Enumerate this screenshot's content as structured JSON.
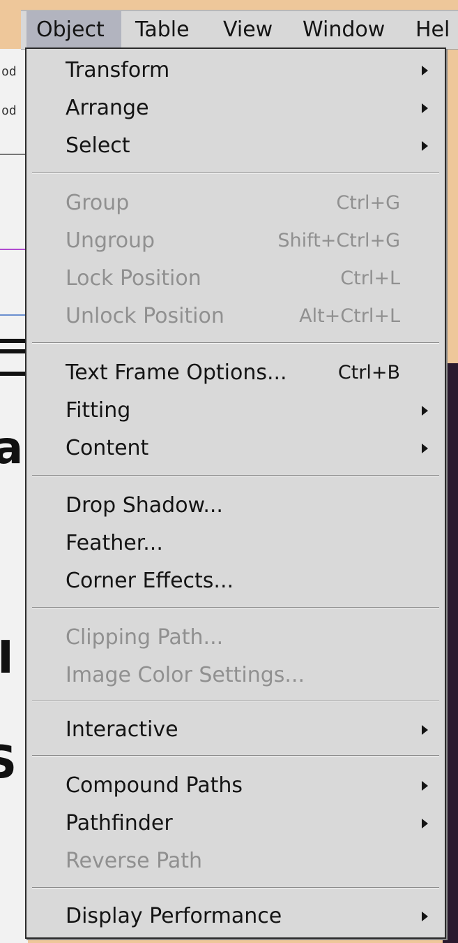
{
  "menubar": {
    "items": [
      {
        "label": "Object",
        "active": true
      },
      {
        "label": "Table"
      },
      {
        "label": "View"
      },
      {
        "label": "Window"
      },
      {
        "label": "Hel"
      }
    ]
  },
  "menu": {
    "items": {
      "transform": {
        "label": "Transform",
        "submenu": true,
        "enabled": true
      },
      "arrange": {
        "label": "Arrange",
        "submenu": true,
        "enabled": true
      },
      "select": {
        "label": "Select",
        "submenu": true,
        "enabled": true
      },
      "group": {
        "label": "Group",
        "shortcut": "Ctrl+G",
        "enabled": false
      },
      "ungroup": {
        "label": "Ungroup",
        "shortcut": "Shift+Ctrl+G",
        "enabled": false
      },
      "lock_position": {
        "label": "Lock Position",
        "shortcut": "Ctrl+L",
        "enabled": false
      },
      "unlock_position": {
        "label": "Unlock Position",
        "shortcut": "Alt+Ctrl+L",
        "enabled": false
      },
      "text_frame_options": {
        "label": "Text Frame Options...",
        "shortcut": "Ctrl+B",
        "enabled": true
      },
      "fitting": {
        "label": "Fitting",
        "submenu": true,
        "enabled": true
      },
      "content": {
        "label": "Content",
        "submenu": true,
        "enabled": true
      },
      "drop_shadow": {
        "label": "Drop Shadow...",
        "enabled": true
      },
      "feather": {
        "label": "Feather...",
        "enabled": true
      },
      "corner_effects": {
        "label": "Corner Effects...",
        "enabled": true
      },
      "clipping_path": {
        "label": "Clipping Path...",
        "enabled": false
      },
      "image_color_settings": {
        "label": "Image Color Settings...",
        "enabled": false
      },
      "interactive": {
        "label": "Interactive",
        "submenu": true,
        "enabled": true
      },
      "compound_paths": {
        "label": "Compound Paths",
        "submenu": true,
        "enabled": true
      },
      "pathfinder": {
        "label": "Pathfinder",
        "submenu": true,
        "enabled": true
      },
      "reverse_path": {
        "label": "Reverse Path",
        "enabled": false
      },
      "display_performance": {
        "label": "Display Performance",
        "submenu": true,
        "enabled": true
      }
    }
  },
  "background": {
    "fragments": [
      "od",
      "od"
    ],
    "big_letters": [
      "a",
      "I",
      "S"
    ]
  },
  "colors": {
    "frame": "#eec79a",
    "menu_bg": "#d9d9d9",
    "menubar_active": "#b2b4bf",
    "text": "#141414",
    "disabled_text": "#909090"
  }
}
